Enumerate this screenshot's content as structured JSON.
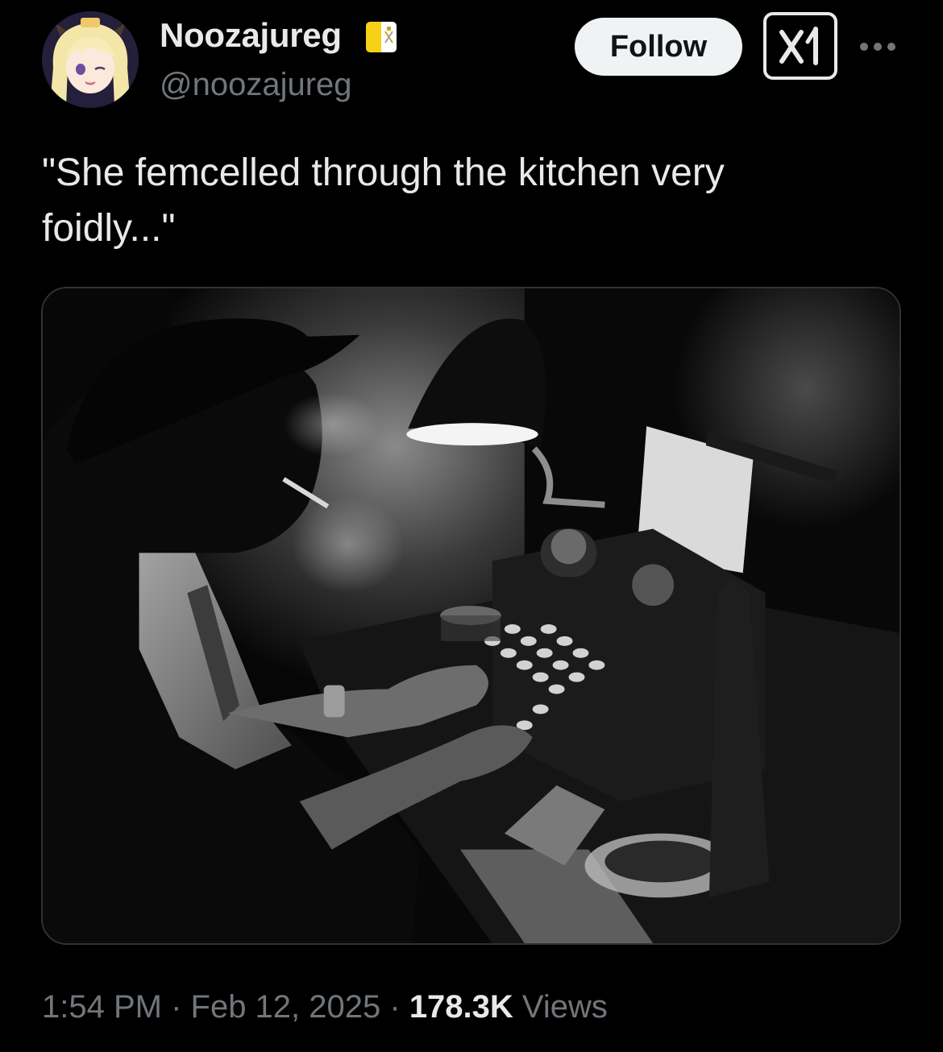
{
  "author": {
    "display_name": "Noozajureg",
    "handle": "@noozajureg",
    "badge_icon": "vatican-flag-icon",
    "avatar_icon": "anime-girl-avatar"
  },
  "actions": {
    "follow_label": "Follow",
    "grok_icon": "grok-icon",
    "more_icon": "more-dots-icon"
  },
  "tweet": {
    "text": "\"She femcelled through the kitchen very\nfoidly...\"",
    "media_icon": "noir-writer-typewriter-photo"
  },
  "meta": {
    "time": "1:54 PM",
    "separator1": " · ",
    "date": "Feb 12, 2025",
    "separator2": " · ",
    "views_count": "178.3K",
    "views_label": " Views"
  },
  "colors": {
    "background": "#000000",
    "primary_text": "#e7e9ea",
    "secondary_text": "#71767b",
    "follow_bg": "#eff3f4",
    "border": "#2f3336",
    "flag_yellow": "#f7d117"
  }
}
